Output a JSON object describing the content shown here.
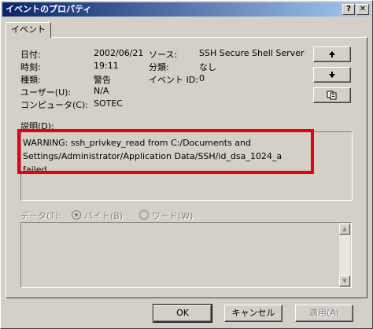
{
  "window": {
    "title": "イベントのプロパティ",
    "help_btn": "?",
    "close_btn": "X"
  },
  "tab": {
    "label": "イベント"
  },
  "fields": {
    "date_label": "日付:",
    "date_value": "2002/06/21",
    "time_label": "時刻:",
    "time_value": "19:11",
    "type_label": "種類:",
    "type_value": "警告",
    "user_label": "ユーザー(U):",
    "user_value": "N/A",
    "computer_label": "コンピュータ(C):",
    "computer_value": "SOTEC",
    "source_label": "ソース:",
    "source_value": "SSH Secure Shell Server",
    "category_label": "分類:",
    "category_value": "なし",
    "eventid_label": "イベント ID:",
    "eventid_value": "0"
  },
  "side_buttons": {
    "up_icon": "arrow-up-icon",
    "down_icon": "arrow-down-icon",
    "copy_icon": "copy-icon"
  },
  "description": {
    "label": "説明(D):",
    "text": "WARNING: ssh_privkey_read from C:/Documents and\nSettings/Administrator/Application Data/SSH/id_dsa_1024_a failed.",
    "highlight_color": "#e8000a"
  },
  "data_section": {
    "label": "データ(T):",
    "byte_option": "バイト(B)",
    "word_option": "ワード(W)",
    "selected": "バイト(B)"
  },
  "footer": {
    "ok": "OK",
    "cancel": "キャンセル",
    "apply": "適用(A)"
  },
  "colors": {
    "face": "#d4d0c8",
    "title_start": "#0a246a",
    "title_end": "#a6caf0"
  }
}
